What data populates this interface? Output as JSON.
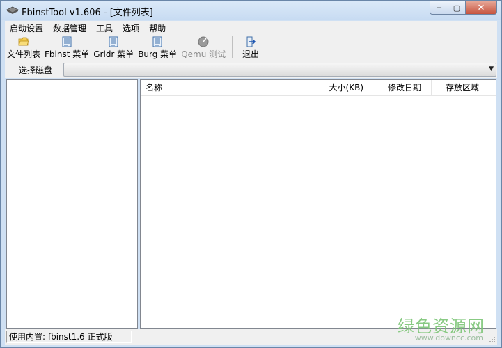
{
  "window": {
    "title": "FbinstTool v1.606 - [文件列表]",
    "buttons": {
      "minimize": "─",
      "maximize": "▢",
      "close": "✕"
    }
  },
  "menubar": {
    "items": [
      "启动设置",
      "数据管理",
      "工具",
      "选项",
      "帮助"
    ]
  },
  "toolbar": {
    "items": [
      {
        "label": "文件列表",
        "icon": "folder-icon",
        "enabled": true
      },
      {
        "label": "Fbinst 菜单",
        "icon": "document-icon",
        "enabled": true
      },
      {
        "label": "Grldr 菜单",
        "icon": "document-icon",
        "enabled": true
      },
      {
        "label": "Burg 菜单",
        "icon": "document-icon",
        "enabled": true
      },
      {
        "label": "Qemu 测试",
        "icon": "disc-icon",
        "enabled": false
      },
      {
        "label": "退出",
        "icon": "exit-icon",
        "enabled": true
      }
    ]
  },
  "disk": {
    "label": "选择磁盘",
    "selected": ""
  },
  "filelist": {
    "columns": [
      "名称",
      "大小(KB)",
      "修改日期",
      "存放区域"
    ],
    "rows": []
  },
  "status": {
    "text": "使用内置: fbinst1.6 正式版"
  },
  "watermark": {
    "text": "绿色资源网",
    "url": "www.downcc.com"
  },
  "colors": {
    "frame": "#cfe0f3",
    "close_button": "#c6533e",
    "watermark": "#7cc576"
  }
}
